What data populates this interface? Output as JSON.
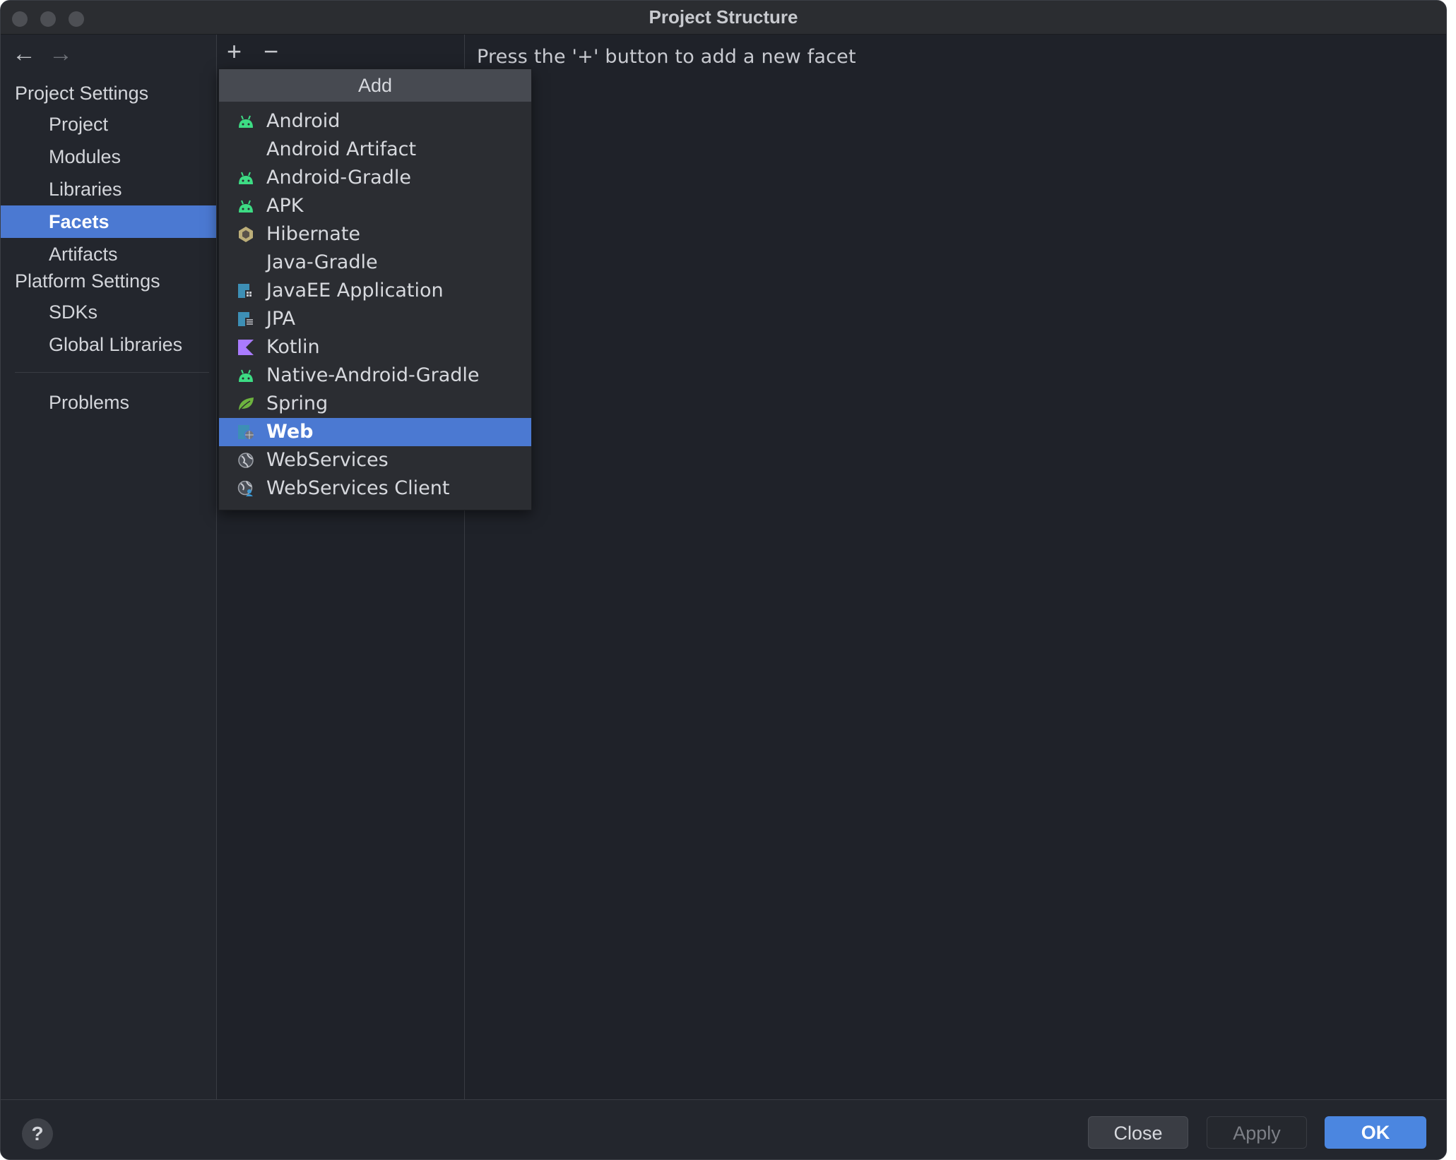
{
  "window": {
    "title": "Project Structure"
  },
  "nav": {
    "back_icon": "arrow-left-icon",
    "forward_icon": "arrow-right-icon"
  },
  "sidebar": {
    "project_settings_label": "Project Settings",
    "project_items": [
      {
        "label": "Project",
        "selected": false
      },
      {
        "label": "Modules",
        "selected": false
      },
      {
        "label": "Libraries",
        "selected": false
      },
      {
        "label": "Facets",
        "selected": true
      },
      {
        "label": "Artifacts",
        "selected": false
      }
    ],
    "platform_settings_label": "Platform Settings",
    "platform_items": [
      {
        "label": "SDKs"
      },
      {
        "label": "Global Libraries"
      }
    ],
    "problems_label": "Problems"
  },
  "toolbar": {
    "add_icon": "plus-icon",
    "remove_icon": "minus-icon"
  },
  "content": {
    "hint": "Press the '+' button to add a new facet"
  },
  "popup": {
    "header": "Add",
    "items": [
      {
        "label": "Android",
        "icon": "android-icon",
        "selected": false
      },
      {
        "label": "Android Artifact",
        "icon": "",
        "selected": false
      },
      {
        "label": "Android-Gradle",
        "icon": "android-icon",
        "selected": false
      },
      {
        "label": "APK",
        "icon": "android-icon",
        "selected": false
      },
      {
        "label": "Hibernate",
        "icon": "hibernate-icon",
        "selected": false
      },
      {
        "label": "Java-Gradle",
        "icon": "",
        "selected": false
      },
      {
        "label": "JavaEE Application",
        "icon": "javaee-icon",
        "selected": false
      },
      {
        "label": "JPA",
        "icon": "jpa-icon",
        "selected": false
      },
      {
        "label": "Kotlin",
        "icon": "kotlin-icon",
        "selected": false
      },
      {
        "label": "Native-Android-Gradle",
        "icon": "android-icon",
        "selected": false
      },
      {
        "label": "Spring",
        "icon": "spring-leaf-icon",
        "selected": false
      },
      {
        "label": "Web",
        "icon": "web-icon",
        "selected": true
      },
      {
        "label": "WebServices",
        "icon": "globe-icon",
        "selected": false
      },
      {
        "label": "WebServices Client",
        "icon": "globe-user-icon",
        "selected": false
      }
    ]
  },
  "footer": {
    "help_label": "?",
    "close_label": "Close",
    "apply_label": "Apply",
    "ok_label": "OK"
  },
  "colors": {
    "selection": "#4b79d2",
    "background": "#1f2229",
    "android_green": "#3ddc84",
    "kotlin_purple": "#a97bff",
    "spring_green": "#6db33f"
  }
}
